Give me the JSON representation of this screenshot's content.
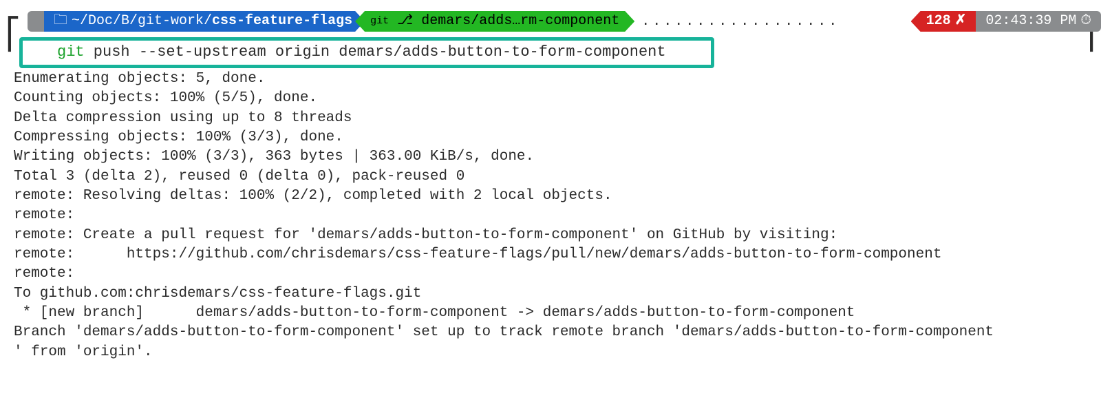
{
  "status": {
    "apple_glyph": "",
    "folder_glyph": "🗀",
    "path_prefix": "~/Doc/B/git-work/",
    "path_bold": "css-feature-flags",
    "git_label": "git",
    "branch_glyph": "⎇",
    "branch_text": "demars/adds…rm-component",
    "dots": "..................",
    "error_code": "128",
    "error_x": "✗",
    "time": "02:43:39 PM",
    "clock_glyph": "⏱"
  },
  "command": {
    "git": "git",
    "rest": " push --set-upstream origin demars/adds-button-to-form-component"
  },
  "output_lines": [
    "Enumerating objects: 5, done.",
    "Counting objects: 100% (5/5), done.",
    "Delta compression using up to 8 threads",
    "Compressing objects: 100% (3/3), done.",
    "Writing objects: 100% (3/3), 363 bytes | 363.00 KiB/s, done.",
    "Total 3 (delta 2), reused 0 (delta 0), pack-reused 0",
    "remote: Resolving deltas: 100% (2/2), completed with 2 local objects.",
    "remote:",
    "remote: Create a pull request for 'demars/adds-button-to-form-component' on GitHub by visiting:",
    "remote:      https://github.com/chrisdemars/css-feature-flags/pull/new/demars/adds-button-to-form-component",
    "remote:",
    "To github.com:chrisdemars/css-feature-flags.git",
    " * [new branch]      demars/adds-button-to-form-component -> demars/adds-button-to-form-component",
    "Branch 'demars/adds-button-to-form-component' set up to track remote branch 'demars/adds-button-to-form-component",
    "' from 'origin'."
  ]
}
